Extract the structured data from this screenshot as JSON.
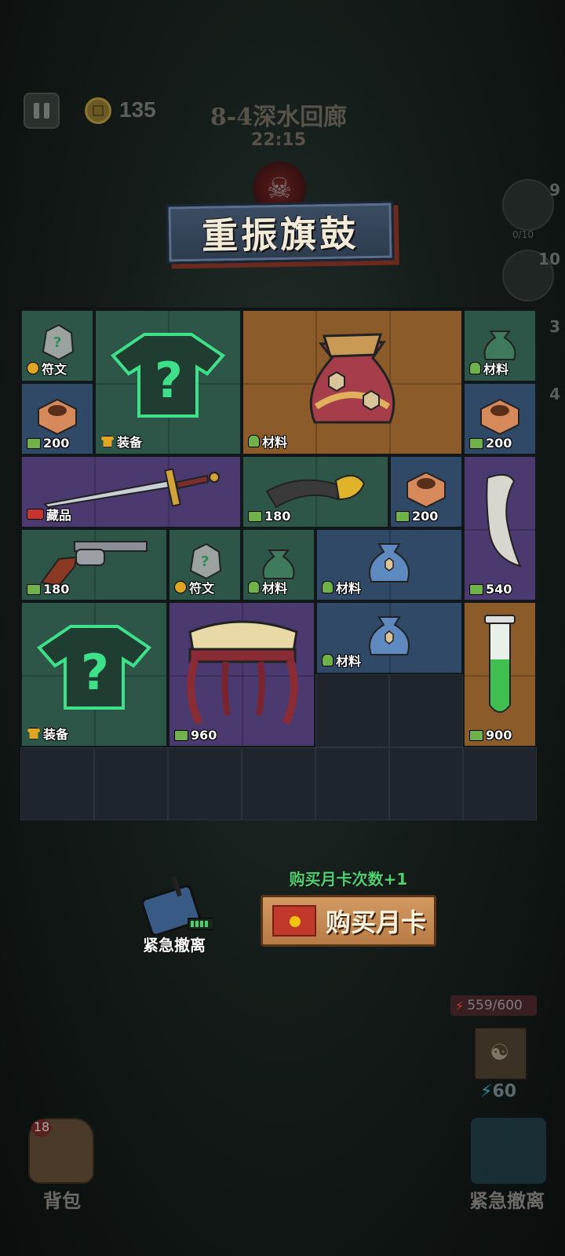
{
  "hud": {
    "coins": "135",
    "level_name": "8-4深水回廊",
    "timer": "22:15",
    "side_slots": [
      "9",
      "10",
      "3",
      "4"
    ],
    "side_sub": "0/10"
  },
  "title": "重振旗鼓",
  "labels": {
    "rune": "符文",
    "equipment": "装备",
    "material": "材料",
    "collectible": "藏品"
  },
  "items": [
    {
      "name": "rune-stone",
      "label": "符文",
      "icon": "rune-icon"
    },
    {
      "name": "mystery-shirt-1",
      "label": "装备",
      "icon": "shirt-icon"
    },
    {
      "name": "big-material-bag",
      "label": "材料",
      "icon": "bag-icon"
    },
    {
      "name": "green-material-bag-1",
      "label": "材料",
      "icon": "bag-icon"
    },
    {
      "name": "copper-nut-1",
      "label": "200",
      "icon": "cash-icon"
    },
    {
      "name": "copper-nut-2",
      "label": "200",
      "icon": "cash-icon"
    },
    {
      "name": "sword",
      "label": "藏品",
      "icon": "treasure-icon"
    },
    {
      "name": "curved-horn",
      "label": "180",
      "icon": "cash-icon"
    },
    {
      "name": "copper-nut-3",
      "label": "200",
      "icon": "cash-icon"
    },
    {
      "name": "tusk",
      "label": "540",
      "icon": "cash-icon"
    },
    {
      "name": "revolver",
      "label": "180",
      "icon": "cash-icon"
    },
    {
      "name": "rune-stone-2",
      "label": "符文",
      "icon": "rune-icon"
    },
    {
      "name": "green-material-bag-2",
      "label": "材料",
      "icon": "bag-icon"
    },
    {
      "name": "blue-material-bag-1",
      "label": "材料",
      "icon": "bag-icon"
    },
    {
      "name": "mystery-shirt-2",
      "label": "装备",
      "icon": "shirt-icon"
    },
    {
      "name": "ornate-stool",
      "label": "960",
      "icon": "cash-icon"
    },
    {
      "name": "blue-material-bag-2",
      "label": "材料",
      "icon": "bag-icon"
    },
    {
      "name": "test-tube",
      "label": "900",
      "icon": "cash-icon"
    }
  ],
  "bottom": {
    "emergency_evac": "紧急撤离",
    "monthly_hint": "购买月卡次数+1",
    "monthly_button": "购买月卡",
    "energy": "559/600",
    "skill_cost": "60",
    "backpack_count": "18",
    "backpack": "背包",
    "evac_corner": "紧急撤离"
  },
  "colors": {
    "green_tile": "#2e5648",
    "blue_tile": "#2f4966",
    "purple_tile": "#4a3a70",
    "orange_tile": "#8b5b2a",
    "highlight_green": "#4fd070"
  }
}
